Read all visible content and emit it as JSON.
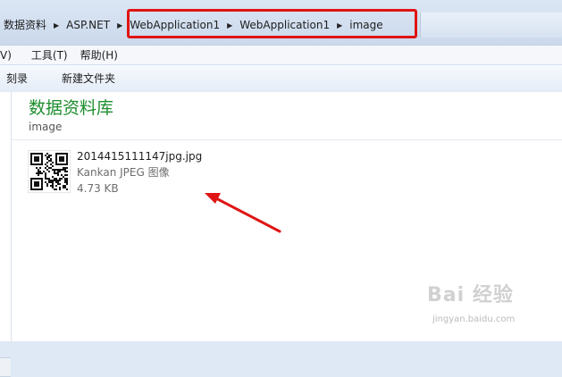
{
  "address": {
    "crumbs": [
      "数据资料",
      "ASP.NET",
      "WebApplication1",
      "WebApplication1",
      "image"
    ]
  },
  "menubar": {
    "items": [
      "V)",
      "工具(T)",
      "帮助(H)"
    ]
  },
  "toolbar": {
    "burn_label": "刻录",
    "new_folder_label": "新建文件夹"
  },
  "library": {
    "title": "数据资料库",
    "subtitle": "image"
  },
  "file": {
    "name": "2014415111147jpg.jpg",
    "type": "Kankan JPEG 图像",
    "size": "4.73 KB"
  },
  "watermark": {
    "brand": "Bai 经验",
    "url": "jingyan.baidu.com"
  },
  "colors": {
    "highlight": "#e01414",
    "library_title": "#1e8e2e",
    "arrow": "#e01414"
  }
}
